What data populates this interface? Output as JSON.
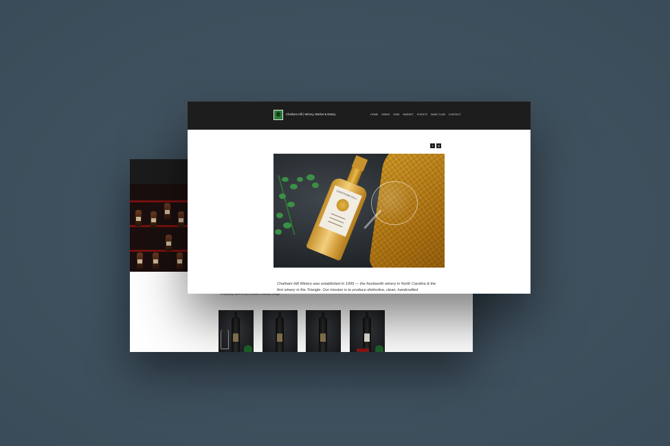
{
  "front_site": {
    "brand_name": "Chatham Hill | Winery, Market & Eatery",
    "nav": [
      "HOME",
      "WINES",
      "DINE",
      "MARKET",
      "EVENTS",
      "WINE CLUB",
      "CONTACT"
    ],
    "social": [
      {
        "icon": "facebook-icon",
        "glyph": "f"
      },
      {
        "icon": "instagram-icon",
        "glyph": "◎"
      }
    ],
    "hero_bottle_label": "CHATHAM HILL",
    "about_text": "Chatham Hill Winery was established in 1999 — the fourteenth winery in North Carolina & the first winery in the Triangle. Our mission is to produce distinctive, clean, handcrafted"
  },
  "back_site": {
    "caption": "Simplifying taste for your bottled Chatham pledge"
  },
  "colors": {
    "background": "#3f5260",
    "header": "#1d1d1d",
    "accent_green": "#2c7a39",
    "towel_gold": "#d9a02a"
  }
}
